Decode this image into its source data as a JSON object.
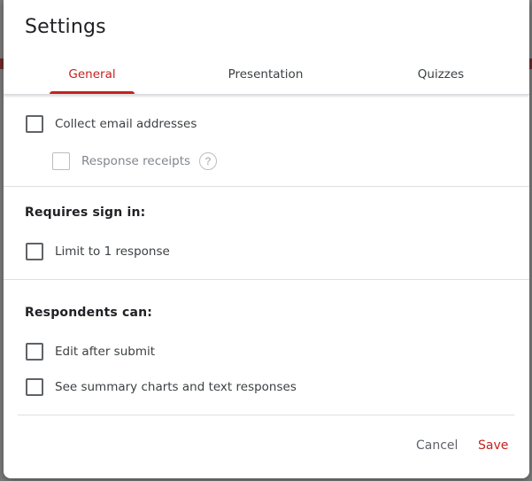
{
  "dialog": {
    "title": "Settings",
    "tabs": [
      {
        "label": "General",
        "active": true
      },
      {
        "label": "Presentation",
        "active": false
      },
      {
        "label": "Quizzes",
        "active": false
      }
    ]
  },
  "general": {
    "collect_email": {
      "label": "Collect email addresses",
      "checked": false
    },
    "response_receipts": {
      "label": "Response receipts",
      "checked": false,
      "disabled": true,
      "help_icon": "help-circle-icon",
      "help_glyph": "?"
    },
    "requires_sign_in": {
      "heading": "Requires sign in:",
      "limit_one": {
        "label": "Limit to 1 response",
        "checked": false
      }
    },
    "respondents_can": {
      "heading": "Respondents can:",
      "edit_after_submit": {
        "label": "Edit after submit",
        "checked": false
      },
      "see_summary": {
        "label": "See summary charts and text responses",
        "checked": false
      }
    }
  },
  "footer": {
    "cancel_label": "Cancel",
    "save_label": "Save"
  },
  "colors": {
    "accent": "#c5221f",
    "text": "#3c4043",
    "muted": "#5f6368"
  }
}
